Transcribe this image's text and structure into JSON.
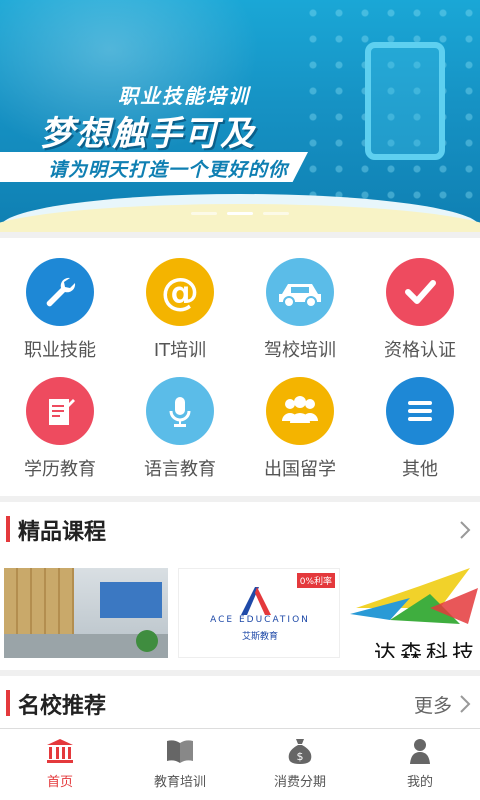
{
  "banner": {
    "line1": "职业技能培训",
    "line2": "梦想触手可及",
    "line3": "请为明天打造一个更好的你",
    "dots": 3,
    "active_dot": 2
  },
  "categories": [
    {
      "label": "职业技能",
      "icon": "wrench-icon",
      "color": "#1e88d6"
    },
    {
      "label": "IT培训",
      "icon": "at-icon",
      "color": "#f4b400"
    },
    {
      "label": "驾校培训",
      "icon": "car-icon",
      "color": "#5bbce8"
    },
    {
      "label": "资格认证",
      "icon": "checkmark-icon",
      "color": "#ee4b5f"
    },
    {
      "label": "学历教育",
      "icon": "document-pen-icon",
      "color": "#ee4b5f"
    },
    {
      "label": "语言教育",
      "icon": "microphone-icon",
      "color": "#5bbce8"
    },
    {
      "label": "出国留学",
      "icon": "group-icon",
      "color": "#f4b400"
    },
    {
      "label": "其他",
      "icon": "menu-icon",
      "color": "#1e88d6"
    }
  ],
  "featured": {
    "title": "精品课程",
    "courses": [
      {
        "name": "office-photo"
      },
      {
        "brand": "ACE",
        "brand_sub": "EDUCATION",
        "brand_cn": "艾斯教育",
        "tag": "0%利率"
      },
      {
        "text": "达森科技"
      }
    ]
  },
  "schools": {
    "title": "名校推荐",
    "more": "更多"
  },
  "nav": {
    "items": [
      {
        "label": "首页",
        "icon": "home-icon",
        "active": true
      },
      {
        "label": "教育培训",
        "icon": "book-icon",
        "active": false
      },
      {
        "label": "消费分期",
        "icon": "money-bag-icon",
        "active": false
      },
      {
        "label": "我的",
        "icon": "person-icon",
        "active": false
      }
    ]
  },
  "colors": {
    "accent": "#e4393c",
    "banner": "#1692c4"
  }
}
